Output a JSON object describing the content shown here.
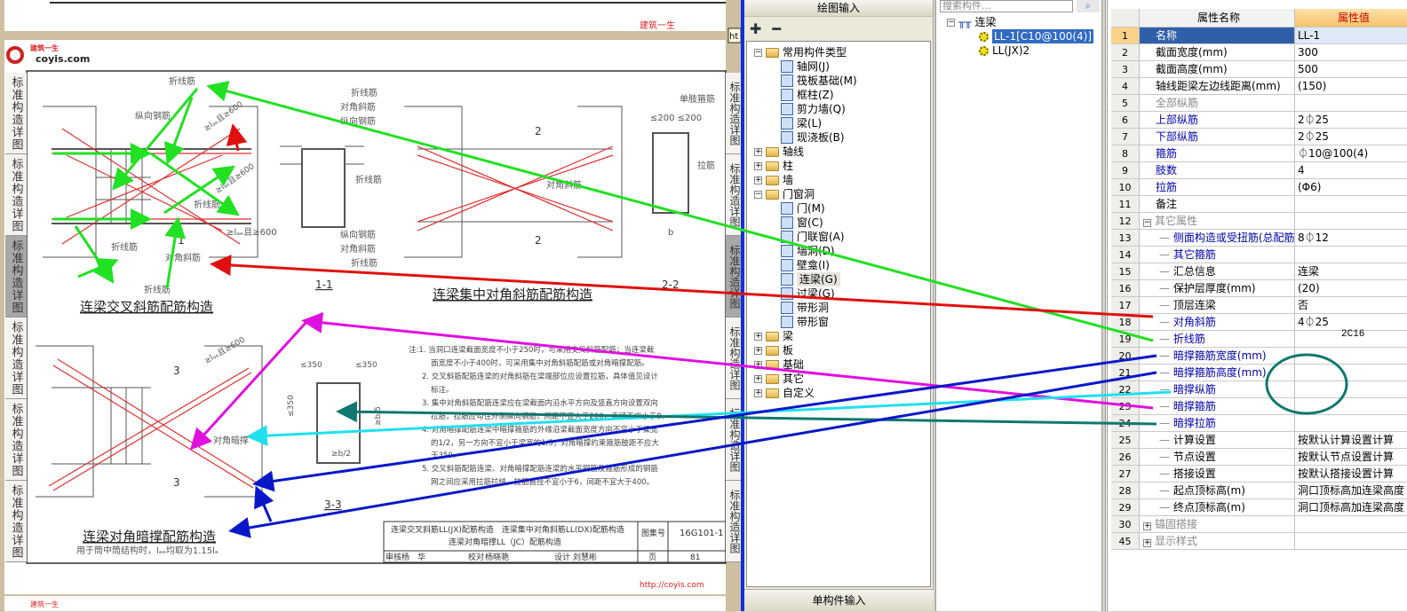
{
  "viewer": {
    "watermark_cn": "建筑一生",
    "watermark_url": "http://coyis.com",
    "watermark_url_short": "http://coyis.",
    "logo_text": "coyis.com",
    "tooltip": "ht",
    "side_tab_label": "标准构造详图",
    "fig1": {
      "title": "连梁交叉斜筋配筋构造",
      "labels": [
        "折线筋",
        "纵向钢筋",
        "折线筋",
        "对角斜筋",
        "折线筋",
        "折线筋"
      ],
      "dim1": "≥lₐₑ且≥600",
      "dim2": "≥lₐₑ且≥600",
      "dim3": "≥lₐₑ且≥600",
      "sec": "1"
    },
    "sec11": {
      "title": "1-1",
      "labels": [
        "折线筋",
        "对角斜筋",
        "纵向钢筋",
        "折线筋",
        "纵向钢筋",
        "对角斜筋",
        "折线筋"
      ]
    },
    "fig2": {
      "title": "连梁集中对角斜筋配筋构造",
      "labels": [
        "单肢箍筋",
        "拉筋",
        "对角斜筋"
      ],
      "dim": "≤200 ≤200",
      "sec": "2",
      "dim200": "≤200",
      "b": "b"
    },
    "sec22": {
      "title": "2-2"
    },
    "fig3": {
      "title": "连梁对角暗撑配筋构造",
      "subtitle": "用于筒中筒结构时，lₐₑ均取为1.15lₐ",
      "label": "对角暗撑",
      "dim": "≥lₐₑ且≥600",
      "sec": "3"
    },
    "sec33": {
      "title": "3-3",
      "d1": "≤350",
      "d2": "≤350",
      "d3": "≤350",
      "d4": "≥b/5",
      "d5": "≥b/2"
    },
    "notes": [
      "注:1. 当洞口连梁截面宽度不小于250时，可采用交叉斜筋配筋；当连梁截",
      "面宽度不小于400时，可采用集中对角斜筋配筋或对角暗撑配筋。",
      "2. 交叉斜筋配筋连梁的对角斜筋在梁端部位应设置拉筋，具体值见设计",
      "标注。",
      "3. 集中对角斜筋配筋连梁应在梁截面内沿水平方向及竖直方向设置双向",
      "拉筋，拉筋应勾住外侧纵向钢筋，间距不宜大于200，直径不应小于8。",
      "4. 对角暗撑配筋连梁中暗撑箍筋的外缘沿梁截面宽度方向不宜小于梁宽",
      "的1/2，另一方向不宜小于梁宽的1/5；对角暗撑约束箍筋肢距不应大",
      "于350。",
      "5. 交叉斜筋配筋连梁、对角暗撑配筋连梁的水平钢筋及箍筋形成的钢筋",
      "网之间应采用拉筋拉结，拉筋直径不宜小于6，间距不宜大于400。"
    ],
    "titleblock": {
      "line1": "连梁交叉斜筋LL(JX)配筋构造　连梁集中对角斜筋LL(DX)配筋构造",
      "line2": "连梁对角暗撑LL（JC）配筋构造",
      "atlas_label": "图集号",
      "atlas_no": "16G101-1",
      "page_label": "页",
      "page_no": "81",
      "review": "审核",
      "reviewer": "杨　华",
      "check": "校对",
      "checker": "杨晓艳",
      "design": "设计",
      "designer": "刘慧彬"
    }
  },
  "tree": {
    "header": "绘图输入",
    "footer": "单构件输入",
    "expand_all": "✚",
    "collapse_all": "━",
    "items": [
      {
        "label": "常用构件类型",
        "level": 0,
        "state": "−",
        "icon": "folder-open-icon"
      },
      {
        "label": "轴网(J)",
        "level": 1,
        "icon": "grid-icon"
      },
      {
        "label": "筏板基础(M)",
        "level": 1,
        "icon": "raft-icon"
      },
      {
        "label": "框柱(Z)",
        "level": 1,
        "icon": "column-icon"
      },
      {
        "label": "剪力墙(Q)",
        "level": 1,
        "icon": "shear-wall-icon"
      },
      {
        "label": "梁(L)",
        "level": 1,
        "icon": "beam-icon"
      },
      {
        "label": "现浇板(B)",
        "level": 1,
        "icon": "slab-icon"
      },
      {
        "label": "轴线",
        "level": 0,
        "state": "+",
        "icon": "folder-icon"
      },
      {
        "label": "柱",
        "level": 0,
        "state": "+",
        "icon": "folder-icon"
      },
      {
        "label": "墙",
        "level": 0,
        "state": "+",
        "icon": "folder-icon"
      },
      {
        "label": "门窗洞",
        "level": 0,
        "state": "−",
        "icon": "folder-open-icon"
      },
      {
        "label": "门(M)",
        "level": 1,
        "icon": "door-icon"
      },
      {
        "label": "窗(C)",
        "level": 1,
        "icon": "window-icon"
      },
      {
        "label": "门联窗(A)",
        "level": 1,
        "icon": "door-window-icon"
      },
      {
        "label": "墙洞(D)",
        "level": 1,
        "icon": "wall-hole-icon"
      },
      {
        "label": "壁龛(I)",
        "level": 1,
        "icon": "niche-icon"
      },
      {
        "label": "连梁(G)",
        "level": 1,
        "icon": "coupling-beam-icon",
        "selected": true
      },
      {
        "label": "过梁(G)",
        "level": 1,
        "icon": "lintel-icon"
      },
      {
        "label": "带形洞",
        "level": 1,
        "icon": "strip-hole-icon"
      },
      {
        "label": "带形窗",
        "level": 1,
        "icon": "strip-window-icon"
      },
      {
        "label": "梁",
        "level": 0,
        "state": "+",
        "icon": "folder-icon"
      },
      {
        "label": "板",
        "level": 0,
        "state": "+",
        "icon": "folder-icon"
      },
      {
        "label": "基础",
        "level": 0,
        "state": "+",
        "icon": "folder-icon"
      },
      {
        "label": "其它",
        "level": 0,
        "state": "+",
        "icon": "folder-icon"
      },
      {
        "label": "自定义",
        "level": 0,
        "state": "+",
        "icon": "folder-icon"
      }
    ]
  },
  "list": {
    "search_placeholder": "搜索构件...",
    "root": "连梁",
    "items": [
      "LL-1[C10@100(4)]",
      "LL(JX)2"
    ],
    "selected": 0
  },
  "props": {
    "col_name": "属性名称",
    "col_value": "属性值",
    "rows": [
      {
        "n": "1",
        "name": "名称",
        "value": "LL-1",
        "style": "sel"
      },
      {
        "n": "2",
        "name": "截面宽度(mm)",
        "value": "300"
      },
      {
        "n": "3",
        "name": "截面高度(mm)",
        "value": "500"
      },
      {
        "n": "4",
        "name": "轴线距梁左边线距离(mm)",
        "value": "(150)"
      },
      {
        "n": "5",
        "name": "全部纵筋",
        "value": "",
        "style": "gray"
      },
      {
        "n": "6",
        "name": "上部纵筋",
        "value": "2⏀25",
        "style": "blue"
      },
      {
        "n": "7",
        "name": "下部纵筋",
        "value": "2⏀25",
        "style": "blue"
      },
      {
        "n": "8",
        "name": "箍筋",
        "value": "⏀10@100(4)",
        "style": "blue"
      },
      {
        "n": "9",
        "name": "肢数",
        "value": "4",
        "style": "blue"
      },
      {
        "n": "10",
        "name": "拉筋",
        "value": "(Φ6)",
        "style": "blue"
      },
      {
        "n": "11",
        "name": "备注",
        "value": ""
      },
      {
        "n": "12",
        "name": "其它属性",
        "value": "",
        "style": "gray",
        "group": "−"
      },
      {
        "n": "13",
        "name": "侧面构造或受扭筋(总配筋值)",
        "value": "8⏀12",
        "style": "blue",
        "child": true
      },
      {
        "n": "14",
        "name": "其它箍筋",
        "value": "",
        "style": "blue",
        "child": true
      },
      {
        "n": "15",
        "name": "汇总信息",
        "value": "连梁",
        "child": true
      },
      {
        "n": "16",
        "name": "保护层厚度(mm)",
        "value": "(20)",
        "child": true
      },
      {
        "n": "17",
        "name": "顶层连梁",
        "value": "否",
        "child": true
      },
      {
        "n": "18",
        "name": "对角斜筋",
        "value": "4⏀25",
        "style": "blue",
        "child": true
      },
      {
        "n": "19",
        "name": "折线筋",
        "value": "",
        "style": "blue",
        "child": true
      },
      {
        "n": "20",
        "name": "暗撑箍筋宽度(mm)",
        "value": "",
        "style": "blue",
        "child": true
      },
      {
        "n": "21",
        "name": "暗撑箍筋高度(mm)",
        "value": "",
        "style": "blue",
        "child": true
      },
      {
        "n": "22",
        "name": "暗撑纵筋",
        "value": "",
        "style": "blue",
        "child": true
      },
      {
        "n": "23",
        "name": "暗撑箍筋",
        "value": "",
        "style": "blue",
        "child": true
      },
      {
        "n": "24",
        "name": "暗撑拉筋",
        "value": "",
        "style": "blue",
        "child": true
      },
      {
        "n": "25",
        "name": "计算设置",
        "value": "按默认计算设置计算",
        "child": true
      },
      {
        "n": "26",
        "name": "节点设置",
        "value": "按默认节点设置计算",
        "child": true
      },
      {
        "n": "27",
        "name": "搭接设置",
        "value": "按默认搭接设置计算",
        "child": true
      },
      {
        "n": "28",
        "name": "起点顶标高(m)",
        "value": "洞口顶标高加连梁高度",
        "child": true
      },
      {
        "n": "29",
        "name": "终点顶标高(m)",
        "value": "洞口顶标高加连梁高度",
        "child": true
      },
      {
        "n": "30",
        "name": "锚固搭接",
        "value": "",
        "style": "gray",
        "group": "+"
      },
      {
        "n": "45",
        "name": "显示样式",
        "value": "",
        "style": "gray",
        "group": "+"
      }
    ],
    "annotation": "2C16"
  },
  "colors": {
    "green": "#22e022",
    "red": "#e01010",
    "magenta": "#e010e0",
    "cyan": "#20e0f0",
    "teal": "#107870",
    "blue": "#0818c8",
    "rebar": "#e03030"
  }
}
